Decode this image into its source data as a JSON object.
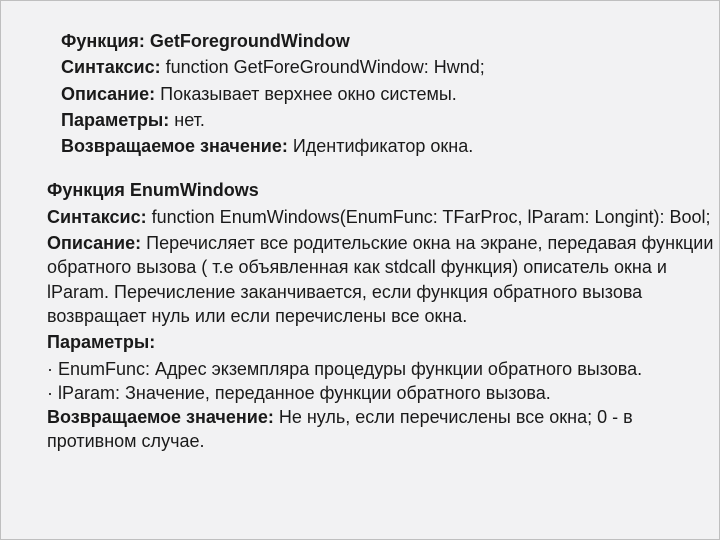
{
  "func1": {
    "name_label": "Функция:",
    "name_value": "GetForegroundWindow",
    "syntax_label": "Синтаксис:",
    "syntax_value": "function GetForeGroundWindow: Hwnd;",
    "desc_label": "Описание:",
    "desc_value": "Показывает верхнее окно системы.",
    "params_label": "Параметры:",
    "params_value": "нет.",
    "return_label": "Возвращаемое значение:",
    "return_value": "Идентификатор окна."
  },
  "func2": {
    "name_label": "Функция",
    "name_value": "EnumWindows",
    "syntax_label": "Синтаксис:",
    "syntax_value": "function EnumWindows(EnumFunc: TFarProc, lParam: Longint): Bool;",
    "desc_label": "Описание:",
    "desc_value": "Перечисляет все родительские окна на экране, передавая функции обратного вызова ( т.е объявленная как stdcall функция) описатель окна и lParam. Перечисление заканчивается, если функция обратного вызова возвращает нуль или если перечислены все окна.",
    "params_label": "Параметры:",
    "bullet1": "·   EnumFunc: Адрес экземпляра процедуры функции обратного вызова.",
    "bullet2": "·   lParam: Значение, переданное функции обратного вызова.",
    "return_label": "Возвращаемое значение:",
    "return_value": "Не нуль, если перечислены все окна; 0 - в противном случае."
  }
}
